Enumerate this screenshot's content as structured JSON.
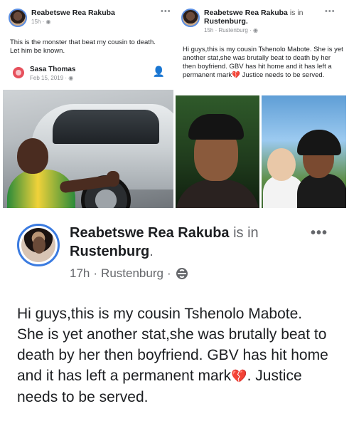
{
  "collage": {
    "left_card": {
      "author": "Reabetswe Rea Rakuba",
      "time": "15h · ",
      "text": "This is the monster that beat my cousin to death. Let him be known.",
      "tag": {
        "name": "Sasa Thomas",
        "date": "Feb 15, 2019 · "
      },
      "icons": [
        "globe-icon",
        "add-friend-icon",
        "more-icon"
      ]
    },
    "right_card": {
      "author": "Reabetswe Rea Rakuba",
      "is_in": "is in",
      "location": "Rustenburg",
      "time": "15h · Rustenburg · ",
      "text": "Hi guys,this is my cousin Tshenolo Mabote. She is yet another stat,she was brutally beat to death by her then boyfriend. GBV has hit home and it has left a permanent mark",
      "text_end": "Justice needs to be served."
    }
  },
  "post": {
    "author": "Reabetswe Rea Rakuba",
    "is_in": "is in",
    "location": "Rustenburg",
    "time": "17h",
    "place": "Rustenburg",
    "more": "•••",
    "text_line1": "Hi guys,this is my cousin Tshenolo Mabote.",
    "text_line2": "She is yet another stat,she was brutally beat to death by her then boyfriend. GBV has hit home and it has left a permanent mark",
    "text_line2_end": ". Justice needs to be served.",
    "heart_emoji": "💔",
    "colors": {
      "avatar_ring": "#3b7be0",
      "text": "#1c1e21",
      "muted": "#65676b"
    }
  }
}
